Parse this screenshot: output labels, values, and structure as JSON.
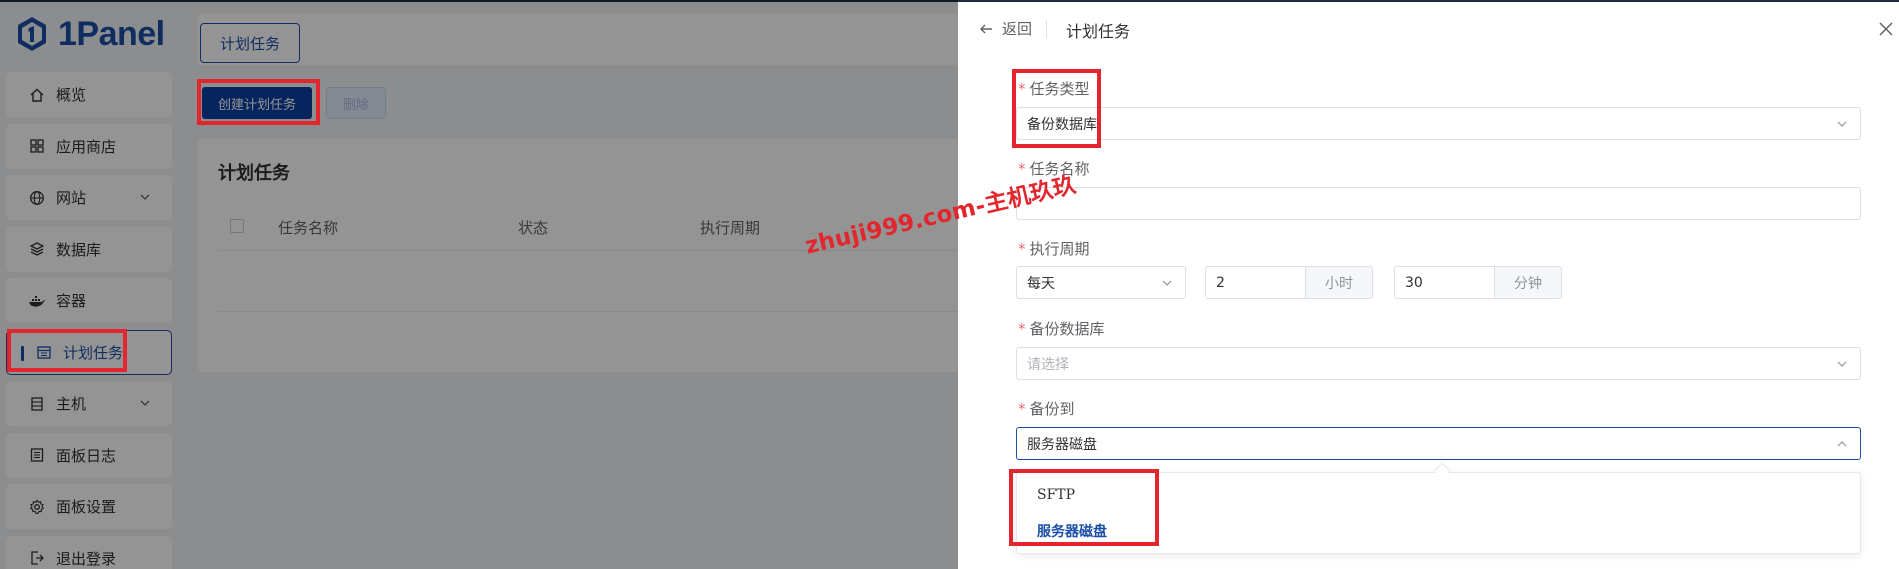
{
  "app": {
    "logo_text": "1Panel"
  },
  "sidebar": {
    "items": [
      {
        "label": "概览",
        "icon": "home-icon"
      },
      {
        "label": "应用商店",
        "icon": "grid-icon"
      },
      {
        "label": "网站",
        "icon": "globe-icon"
      },
      {
        "label": "数据库",
        "icon": "layers-icon"
      },
      {
        "label": "容器",
        "icon": "docker-icon"
      },
      {
        "label": "计划任务",
        "icon": "calendar-icon"
      },
      {
        "label": "主机",
        "icon": "server-icon"
      },
      {
        "label": "面板日志",
        "icon": "log-icon"
      },
      {
        "label": "面板设置",
        "icon": "gear-icon"
      },
      {
        "label": "退出登录",
        "icon": "logout-icon"
      }
    ]
  },
  "main": {
    "tab_label": "计划任务",
    "create_button": "创建计划任务",
    "delete_button": "删除",
    "list_title": "计划任务",
    "columns": [
      "任务名称",
      "状态",
      "执行周期"
    ]
  },
  "drawer": {
    "back_label": "返回",
    "title": "计划任务",
    "task_type": {
      "label": "任务类型",
      "value": "备份数据库"
    },
    "task_name": {
      "label": "任务名称",
      "value": ""
    },
    "cycle": {
      "label": "执行周期",
      "period": "每天",
      "hours": "2",
      "hours_unit": "小时",
      "minutes": "30",
      "minutes_unit": "分钟"
    },
    "backup_db": {
      "label": "备份数据库",
      "placeholder": "请选择"
    },
    "backup_to": {
      "label": "备份到",
      "value": "服务器磁盘",
      "options": [
        "SFTP",
        "服务器磁盘"
      ]
    }
  },
  "watermark": "zhuji999.com-主机玖玖",
  "colors": {
    "primary": "#1d4fa8",
    "button": "#0b3fa3",
    "highlight": "#e3262d",
    "required": "#f56c6c"
  }
}
